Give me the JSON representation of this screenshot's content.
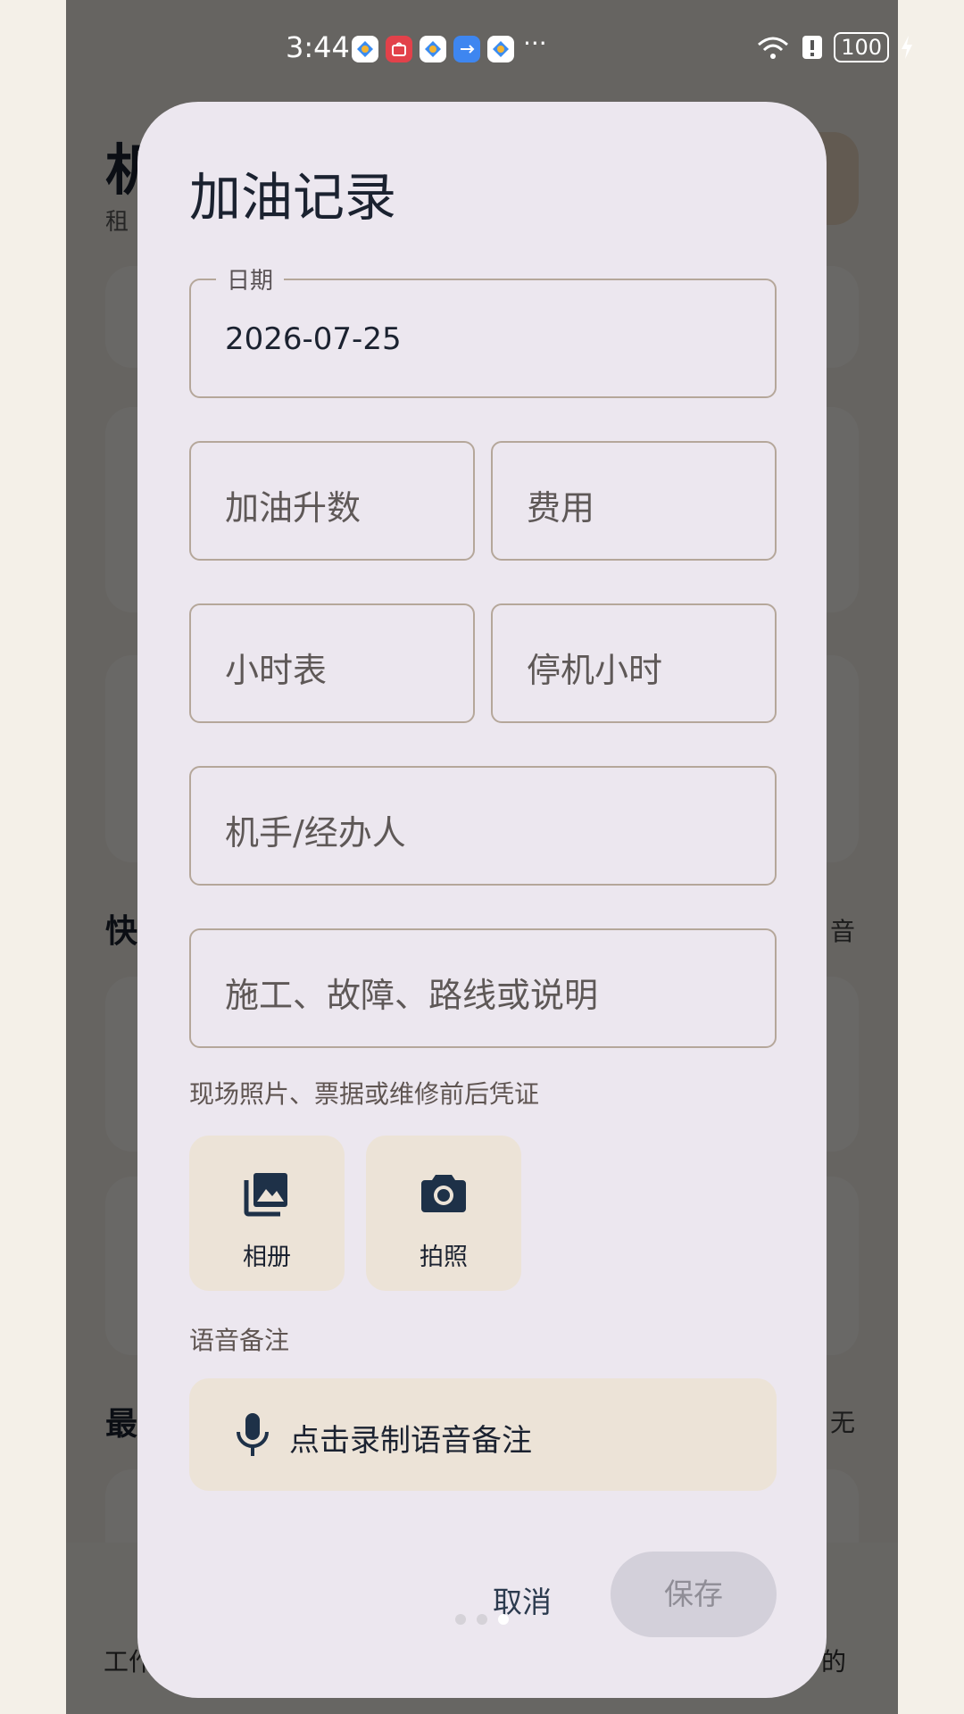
{
  "status_bar": {
    "time": "3:44",
    "notification_more": "···",
    "battery": "100",
    "notification_icons": [
      "app-icon",
      "huawei-store-icon",
      "app-icon",
      "usb-icon",
      "app-icon"
    ]
  },
  "background": {
    "title_partial": "机",
    "subtitle_partial": "租",
    "section1_partial": "快",
    "section1_right": "音",
    "section2_partial": "最",
    "section2_right": "无",
    "nav_left_label": "工作",
    "nav_right_label": "的"
  },
  "dialog": {
    "title": "加油记录",
    "date_field": {
      "label": "日期",
      "value": "2026-07-25"
    },
    "liters_field": {
      "placeholder": "加油升数"
    },
    "cost_field": {
      "placeholder": "费用"
    },
    "hour_meter_field": {
      "placeholder": "小时表"
    },
    "downtime_field": {
      "placeholder": "停机小时"
    },
    "operator_field": {
      "placeholder": "机手/经办人"
    },
    "notes_field": {
      "placeholder": "施工、故障、路线或说明"
    },
    "photos_section_label": "现场照片、票据或维修前后凭证",
    "album_button": "相册",
    "camera_button": "拍照",
    "voice_section_label": "语音备注",
    "voice_button": "点击录制语音备注",
    "cancel_button": "取消",
    "save_button": "保存"
  },
  "colors": {
    "dialog_bg": "#ece7ef",
    "field_border": "#b5a79a",
    "button_tint": "#ece3d7",
    "text_primary": "#1b2230",
    "save_disabled_bg": "#d3d0da"
  }
}
